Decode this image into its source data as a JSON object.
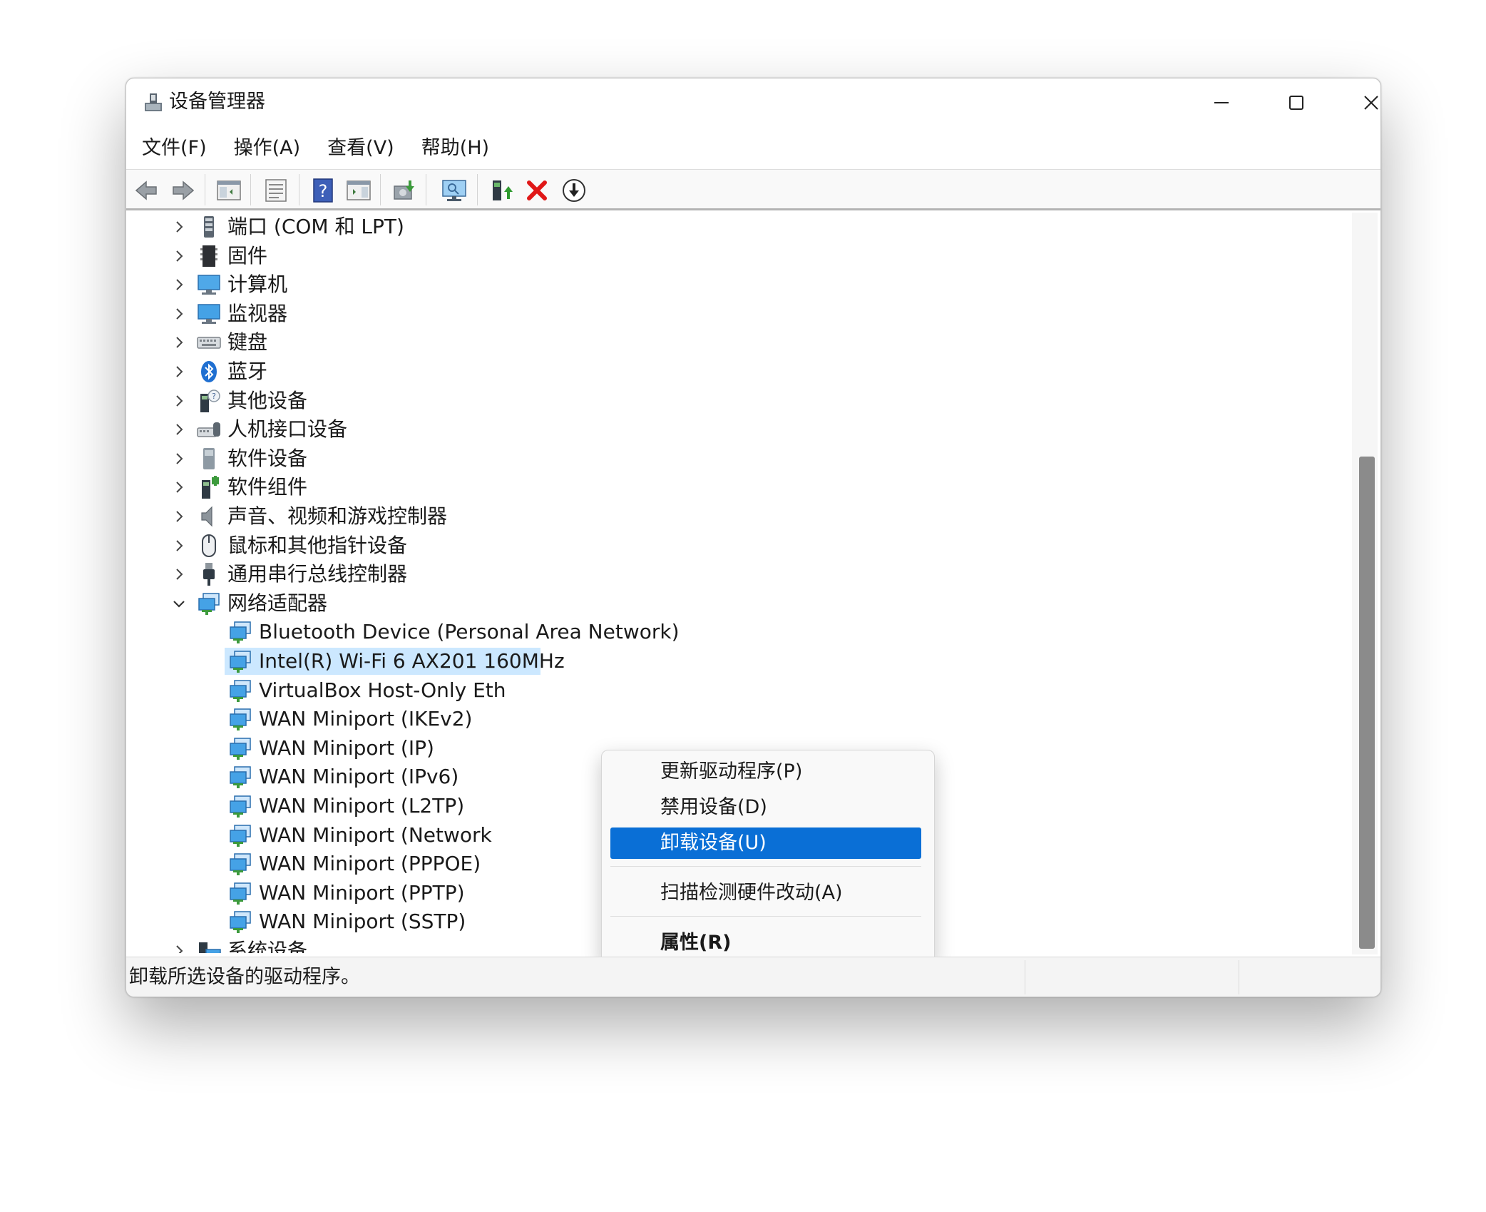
{
  "window": {
    "title": "设备管理器",
    "controls": {
      "minimize": "minimize-icon",
      "maximize": "maximize-icon",
      "close": "close-icon"
    }
  },
  "menubar": {
    "file": "文件(F)",
    "action": "操作(A)",
    "view": "查看(V)",
    "help": "帮助(H)"
  },
  "toolbar": {
    "icons": [
      "back-icon",
      "forward-icon",
      "show-hide-tree-icon",
      "properties-icon",
      "help-icon",
      "action-pane-icon",
      "scan-hardware-icon",
      "monitor-icon",
      "update-driver-icon",
      "uninstall-icon",
      "disable-icon"
    ]
  },
  "tree": {
    "categories": [
      {
        "label": "端口 (COM 和 LPT)",
        "icon": "port-icon",
        "expanded": false
      },
      {
        "label": "固件",
        "icon": "firmware-icon",
        "expanded": false
      },
      {
        "label": "计算机",
        "icon": "computer-icon",
        "expanded": false
      },
      {
        "label": "监视器",
        "icon": "monitor-icon",
        "expanded": false
      },
      {
        "label": "键盘",
        "icon": "keyboard-icon",
        "expanded": false
      },
      {
        "label": "蓝牙",
        "icon": "bluetooth-icon",
        "expanded": false
      },
      {
        "label": "其他设备",
        "icon": "unknown-device-icon",
        "expanded": false
      },
      {
        "label": "人机接口设备",
        "icon": "hid-icon",
        "expanded": false
      },
      {
        "label": "软件设备",
        "icon": "software-device-icon",
        "expanded": false
      },
      {
        "label": "软件组件",
        "icon": "software-component-icon",
        "expanded": false
      },
      {
        "label": "声音、视频和游戏控制器",
        "icon": "speaker-icon",
        "expanded": false
      },
      {
        "label": "鼠标和其他指针设备",
        "icon": "mouse-icon",
        "expanded": false
      },
      {
        "label": "通用串行总线控制器",
        "icon": "usb-icon",
        "expanded": false
      },
      {
        "label": "网络适配器",
        "icon": "network-adapter-icon",
        "expanded": true
      }
    ],
    "network_adapters": [
      {
        "label": "Bluetooth Device (Personal Area Network)",
        "selected": false
      },
      {
        "label": "Intel(R) Wi-Fi 6 AX201 160MHz",
        "selected": true
      },
      {
        "label": "VirtualBox Host-Only Eth",
        "selected": false
      },
      {
        "label": "WAN Miniport (IKEv2)",
        "selected": false
      },
      {
        "label": "WAN Miniport (IP)",
        "selected": false
      },
      {
        "label": "WAN Miniport (IPv6)",
        "selected": false
      },
      {
        "label": "WAN Miniport (L2TP)",
        "selected": false
      },
      {
        "label": "WAN Miniport (Network",
        "selected": false
      },
      {
        "label": "WAN Miniport (PPPOE)",
        "selected": false
      },
      {
        "label": "WAN Miniport (PPTP)",
        "selected": false
      },
      {
        "label": "WAN Miniport (SSTP)",
        "selected": false
      }
    ],
    "after": {
      "label": "系统设备",
      "icon": "system-device-icon",
      "expanded": false
    }
  },
  "context_menu": {
    "update_driver": "更新驱动程序(P)",
    "disable_device": "禁用设备(D)",
    "uninstall_device": "卸载设备(U)",
    "scan_hardware": "扫描检测硬件改动(A)",
    "properties": "属性(R)"
  },
  "status": {
    "text": "卸载所选设备的驱动程序。"
  },
  "colors": {
    "accent": "#0a6fd6",
    "selection": "#cce8ff",
    "scroll_thumb": "#8b8b8b"
  }
}
